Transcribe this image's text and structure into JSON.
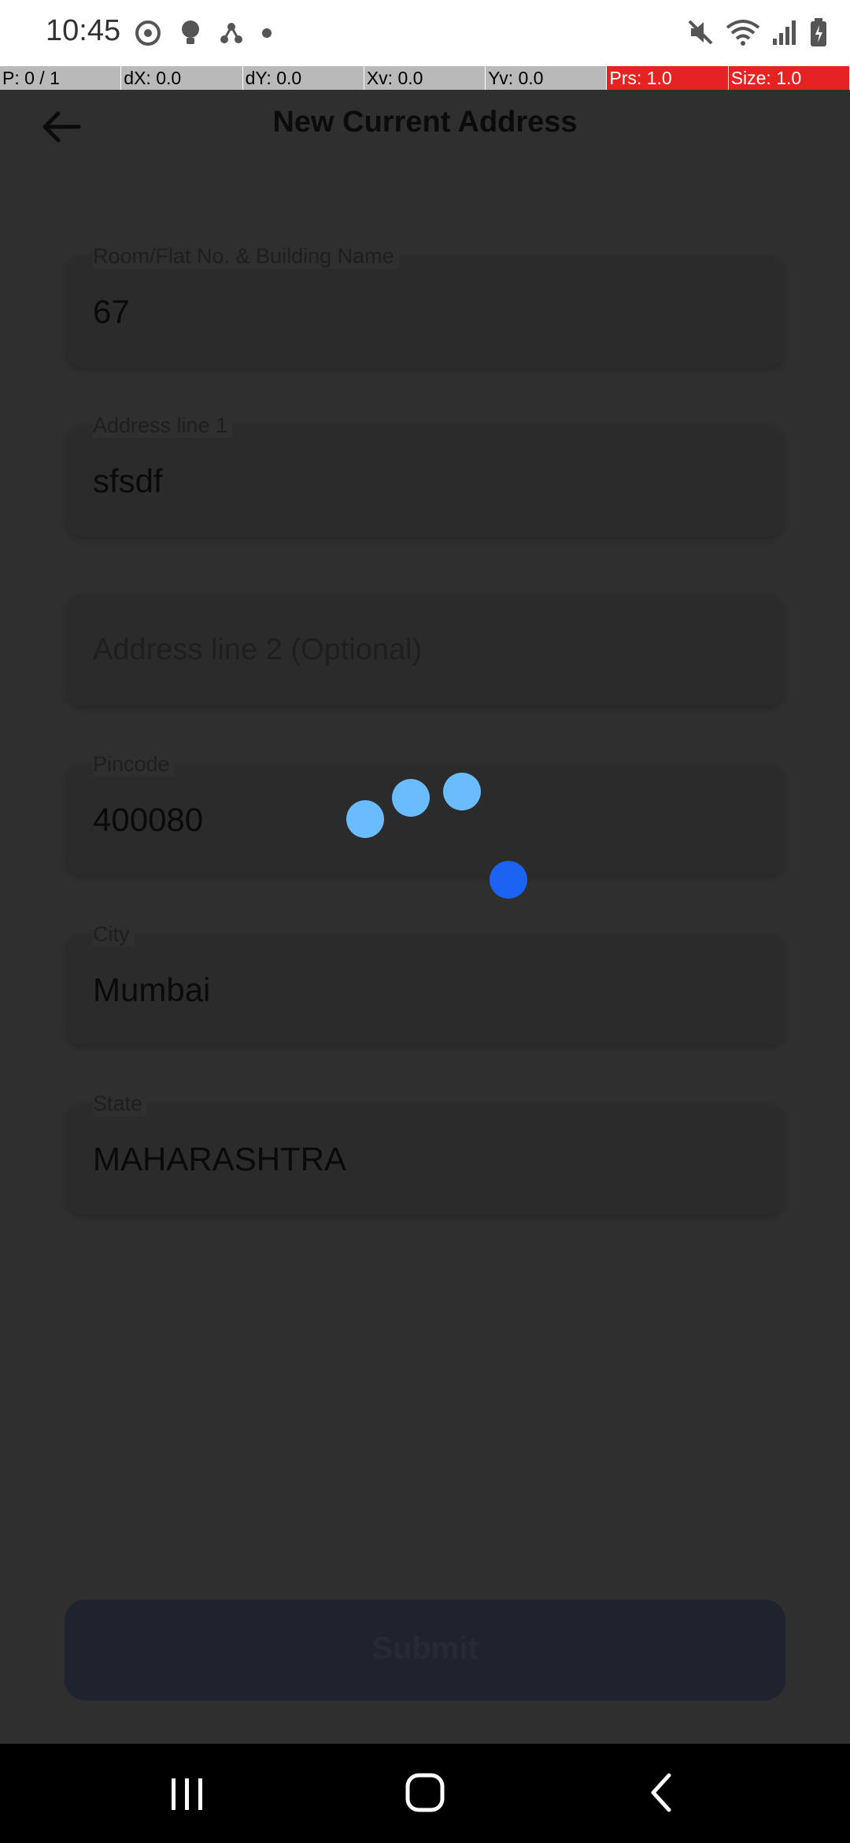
{
  "status": {
    "time": "10:45"
  },
  "debug": {
    "p": "P: 0 / 1",
    "dx": "dX: 0.0",
    "dy": "dY: 0.0",
    "xv": "Xv: 0.0",
    "yv": "Yv: 0.0",
    "prs": "Prs: 1.0",
    "size": "Size: 1.0"
  },
  "header": {
    "title": "New Current Address"
  },
  "form": {
    "room": {
      "label": "Room/Flat No. & Building Name",
      "value": "67"
    },
    "address1": {
      "label": "Address line 1",
      "value": "sfsdf"
    },
    "address2": {
      "placeholder": "Address line 2 (Optional)"
    },
    "pincode": {
      "label": "Pincode",
      "value": "400080"
    },
    "city": {
      "label": "City",
      "value": "Mumbai"
    },
    "state": {
      "label": "State",
      "value": "MAHARASHTRA"
    }
  },
  "submit": {
    "label": "Submit"
  },
  "colors": {
    "overlay": "#2f2f2f",
    "loader_light": "#6bbcff",
    "loader_dark": "#1a63f3",
    "debug_highlight": "#e52322"
  },
  "icons": [
    "back-arrow-icon",
    "mute-icon",
    "wifi-icon",
    "signal-icon",
    "battery-icon",
    "recents-icon",
    "home-icon",
    "nav-back-icon"
  ]
}
